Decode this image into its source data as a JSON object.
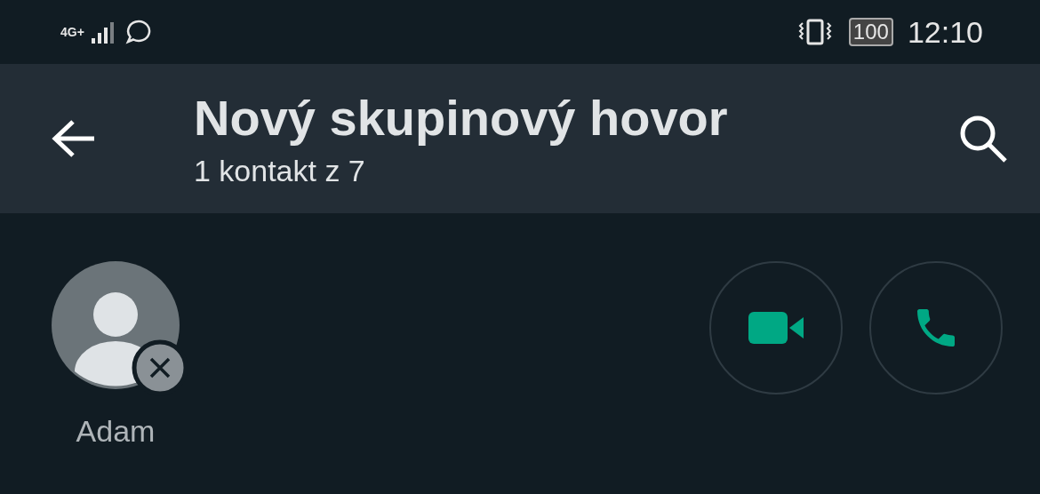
{
  "status_bar": {
    "network": "4G+",
    "battery": "100",
    "time": "12:10"
  },
  "app_bar": {
    "title": "Nový skupinový hovor",
    "subtitle": "1 kontakt z 7"
  },
  "selected_contacts": [
    {
      "name": "Adam"
    }
  ],
  "call_buttons": [
    {
      "kind": "video"
    },
    {
      "kind": "voice"
    }
  ]
}
